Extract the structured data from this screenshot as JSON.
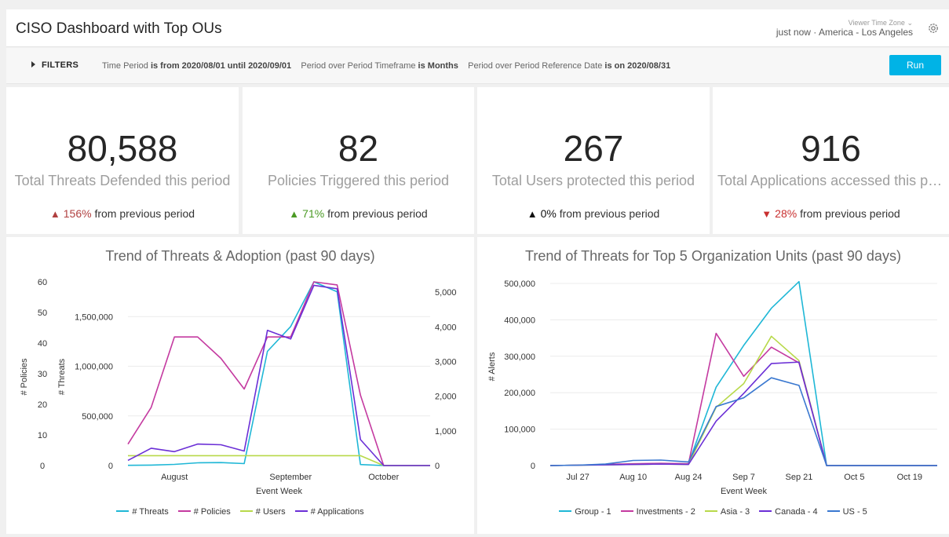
{
  "header": {
    "title": "CISO Dashboard with Top OUs",
    "timezone_label": "Viewer Time Zone",
    "last_updated": "just now",
    "separator": "·",
    "timezone": "America - Los Angeles"
  },
  "filters": {
    "toggle_label": "FILTERS",
    "f1_name": "Time Period",
    "f1_value": "is from 2020/08/01 until 2020/09/01",
    "f2_name": "Period over Period Timeframe",
    "f2_value": "is Months",
    "f3_name": "Period over Period Reference Date",
    "f3_value": "is on 2020/08/31",
    "run_label": "Run"
  },
  "tiles": [
    {
      "value": "80,588",
      "label": "Total Threats Defended this period",
      "change_pct": "156%",
      "change_text": "from previous period",
      "direction": "up",
      "color": "#b04040"
    },
    {
      "value": "82",
      "label": "Policies Triggered this period",
      "change_pct": "71%",
      "change_text": "from previous period",
      "direction": "up",
      "color": "#4a9a24"
    },
    {
      "value": "267",
      "label": "Total Users protected this period",
      "change_pct": "0%",
      "change_text": "from previous period",
      "direction": "up",
      "color": "#111111"
    },
    {
      "value": "916",
      "label": "Total Applications accessed this period",
      "change_pct": "28%",
      "change_text": "from previous period",
      "direction": "down",
      "color": "#c93030"
    }
  ],
  "charts": {
    "left_title": "Trend of Threats & Adoption (past 90 days)",
    "right_title": "Trend of Threats for Top 5 Organization Units (past 90 days)"
  },
  "chart_data": [
    {
      "type": "line",
      "title": "Trend of Threats & Adoption (past 90 days)",
      "xlabel": "Event Week",
      "x_ticks": [
        {
          "label": "August",
          "index": 2
        },
        {
          "label": "September",
          "index": 7
        },
        {
          "label": "October",
          "index": 11
        }
      ],
      "axes": {
        "policies": {
          "label": "# Policies",
          "ylim": [
            0,
            60
          ],
          "ticks": [
            0,
            10,
            20,
            30,
            40,
            50,
            60
          ]
        },
        "threats": {
          "label": "# Threats",
          "ylim": [
            0,
            1850000
          ],
          "ticks": [
            0,
            500000,
            1000000,
            1500000
          ],
          "tick_labels": [
            "0",
            "500,000",
            "1,000,000",
            "1,500,000"
          ]
        },
        "right": {
          "ylim": [
            0,
            5300
          ],
          "ticks": [
            0,
            1000,
            2000,
            3000,
            4000,
            5000
          ],
          "tick_labels": [
            "0",
            "1,000",
            "2,000",
            "3,000",
            "4,000",
            "5,000"
          ]
        }
      },
      "series": [
        {
          "name": "# Threats",
          "axis": "threats",
          "color": "#1fb7d6",
          "values": [
            2000,
            5000,
            12000,
            28000,
            30000,
            20000,
            1150000,
            1400000,
            1850000,
            1750000,
            10000,
            0,
            0,
            0
          ]
        },
        {
          "name": "# Policies",
          "axis": "policies",
          "color": "#c43aa0",
          "values": [
            7,
            19,
            42,
            42,
            35,
            25,
            42,
            42,
            60,
            59,
            23,
            0,
            0,
            0
          ]
        },
        {
          "name": "# Users",
          "axis": "right",
          "color": "#b8d94a",
          "values": [
            285,
            285,
            285,
            285,
            285,
            285,
            285,
            285,
            285,
            285,
            285,
            0,
            0,
            0
          ]
        },
        {
          "name": "# Applications",
          "axis": "right",
          "color": "#6b2fd6",
          "values": [
            150,
            500,
            400,
            620,
            600,
            420,
            3900,
            3650,
            5200,
            5100,
            750,
            0,
            0,
            0
          ]
        }
      ]
    },
    {
      "type": "line",
      "title": "Trend of Threats for Top 5 Organization Units (past 90 days)",
      "xlabel": "Event Week",
      "ylabel": "# Alerts",
      "ylim": [
        0,
        500000
      ],
      "y_ticks": [
        0,
        100000,
        200000,
        300000,
        400000,
        500000
      ],
      "y_tick_labels": [
        "0",
        "100,000",
        "200,000",
        "300,000",
        "400,000",
        "500,000"
      ],
      "x_tick_labels": [
        "Jul 27",
        "Aug 10",
        "Aug 24",
        "Sep 7",
        "Sep 21",
        "Oct 5",
        "Oct 19"
      ],
      "x_tick_index": [
        1,
        3,
        5,
        7,
        9,
        11,
        13
      ],
      "series": [
        {
          "name": "Group - 1",
          "color": "#1fb7d6",
          "values": [
            0,
            1000,
            2000,
            3000,
            4000,
            5000,
            215000,
            330000,
            432000,
            505000,
            0,
            0,
            0,
            0,
            0
          ]
        },
        {
          "name": "Investments - 2",
          "color": "#c43aa0",
          "values": [
            0,
            1000,
            3000,
            5000,
            6000,
            5000,
            363000,
            245000,
            325000,
            282000,
            0,
            0,
            0,
            0,
            0
          ]
        },
        {
          "name": "Asia - 3",
          "color": "#b8d94a",
          "values": [
            0,
            1000,
            2000,
            3000,
            4000,
            3000,
            160000,
            225000,
            355000,
            288000,
            0,
            0,
            0,
            0,
            0
          ]
        },
        {
          "name": "Canada - 4",
          "color": "#6b2fd6",
          "values": [
            0,
            1000,
            2000,
            3000,
            4000,
            3000,
            122000,
            198000,
            280000,
            284000,
            0,
            0,
            0,
            0,
            0
          ]
        },
        {
          "name": "US - 5",
          "color": "#3a78d0",
          "values": [
            0,
            1000,
            4000,
            14000,
            15000,
            10000,
            162000,
            186000,
            241000,
            220000,
            0,
            0,
            0,
            0,
            0
          ]
        }
      ]
    }
  ]
}
